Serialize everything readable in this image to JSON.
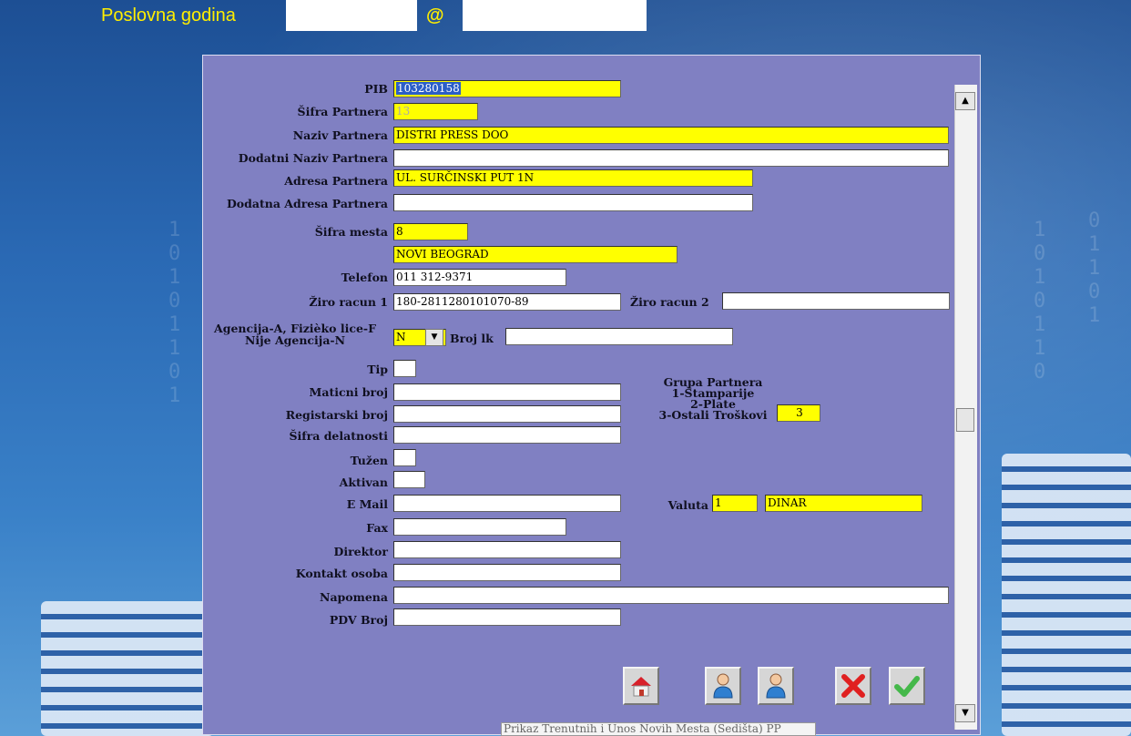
{
  "header": {
    "title": "Poslovna godina",
    "year_value": "",
    "at_symbol": "@",
    "db_value": ""
  },
  "form": {
    "pib": {
      "label": "PIB",
      "value": "103280158"
    },
    "sifra_partnera": {
      "label": "Šifra Partnera",
      "value": "13"
    },
    "naziv_partnera": {
      "label": "Naziv Partnera",
      "value": "DISTRI PRESS DOO"
    },
    "dodatni_naziv": {
      "label": "Dodatni Naziv Partnera",
      "value": ""
    },
    "adresa_partnera": {
      "label": "Adresa Partnera",
      "value": "UL. SURČINSKI PUT 1N"
    },
    "dodatna_adresa": {
      "label": "Dodatna Adresa Partnera",
      "value": ""
    },
    "sifra_mesta": {
      "label": "Šifra mesta",
      "value": "8",
      "mesto_name": "NOVI BEOGRAD"
    },
    "telefon": {
      "label": "Telefon",
      "value": "011 312-9371"
    },
    "ziro_racun_1": {
      "label": "Žiro racun 1",
      "value": "180-2811280101070-89"
    },
    "ziro_racun_2": {
      "label": "Žiro racun 2",
      "value": ""
    },
    "agencija": {
      "label_line1": "Agencija-A, Fizièko lice-F",
      "label_line2": "Nije Agencija-N",
      "value": "N"
    },
    "broj_lk": {
      "label": "Broj lk",
      "value": ""
    },
    "tip": {
      "label": "Tip",
      "value": ""
    },
    "maticni_broj": {
      "label": "Maticni broj",
      "value": ""
    },
    "registarski_broj": {
      "label": "Registarski broj",
      "value": ""
    },
    "sifra_delatnosti": {
      "label": "Šifra delatnosti",
      "value": ""
    },
    "tuzen": {
      "label": "Tužen",
      "value": ""
    },
    "aktivan": {
      "label": "Aktivan",
      "value": ""
    },
    "email": {
      "label": "E Mail",
      "value": ""
    },
    "fax": {
      "label": "Fax",
      "value": ""
    },
    "direktor": {
      "label": "Direktor",
      "value": ""
    },
    "kontakt_osoba": {
      "label": "Kontakt osoba",
      "value": ""
    },
    "napomena": {
      "label": "Napomena",
      "value": ""
    },
    "pdv_broj": {
      "label": "PDV Broj",
      "value": ""
    },
    "grupa_partnera": {
      "line1": "Grupa Partnera",
      "line2": "1-Štamparije",
      "line3": "2-Plate",
      "line4": "3-Ostali Troškovi",
      "value": "3"
    },
    "valuta": {
      "label": "Valuta",
      "code": "1",
      "name": "DINAR"
    }
  },
  "status_bar": {
    "text": "Prikaz Trenutnih i Unos Novih Mesta (Sedišta) PP"
  },
  "colors": {
    "form_bg": "#8080c2",
    "highlight": "#ffff00",
    "title": "#ffee00"
  },
  "icons": [
    "home-icon",
    "user-icon",
    "user-icon",
    "cancel-x-icon",
    "confirm-check-icon",
    "scroll-up-icon",
    "scroll-down-icon",
    "dropdown-arrow-icon"
  ]
}
